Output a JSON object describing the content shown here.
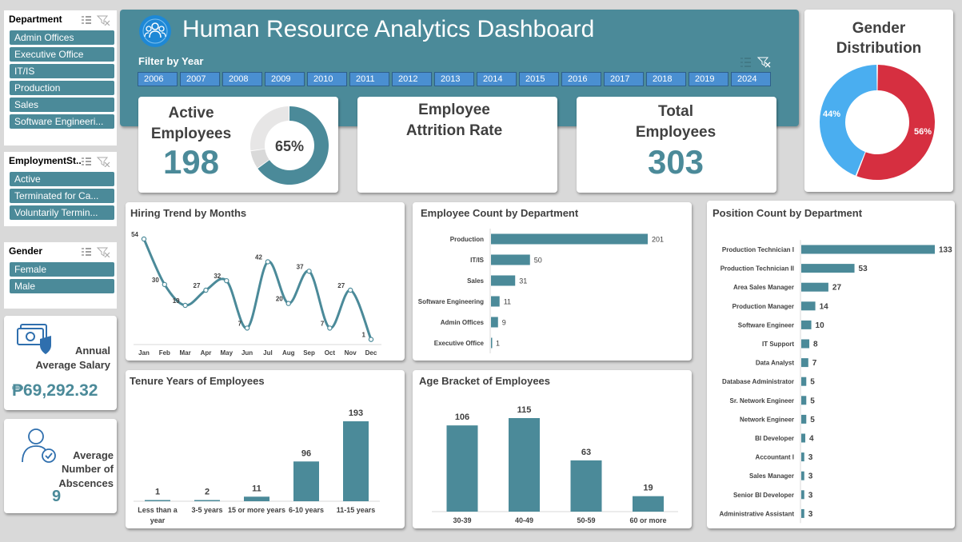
{
  "colors": {
    "teal": "#4b8a99",
    "blue": "#4aaef0",
    "red": "#d62f40",
    "grey": "#d9d9d9"
  },
  "slicers": {
    "department": {
      "title": "Department",
      "items": [
        "Admin Offices",
        "Executive Office",
        "IT/IS",
        "Production",
        "Sales",
        "Software Engineeri..."
      ]
    },
    "employment_status": {
      "title": "EmploymentSt...",
      "items": [
        "Active",
        "Terminated for Ca...",
        "Voluntarily Termin..."
      ]
    },
    "gender": {
      "title": "Gender",
      "items": [
        "Female",
        "Male"
      ]
    }
  },
  "header": {
    "title": "Human Resource Analytics Dashboard",
    "filter_label": "Filter by Year",
    "years": [
      "2006",
      "2007",
      "2008",
      "2009",
      "2010",
      "2011",
      "2012",
      "2013",
      "2014",
      "2015",
      "2016",
      "2017",
      "2018",
      "2019",
      "2024"
    ]
  },
  "kpis": {
    "active": {
      "title_line1": "Active",
      "title_line2": "Employees",
      "value": "198",
      "percent": "65%",
      "fraction": 0.65
    },
    "attrition": {
      "title_line1": "Employee",
      "title_line2": "Attrition Rate"
    },
    "total": {
      "title_line1": "Total",
      "title_line2": "Employees",
      "value": "303"
    },
    "salary": {
      "title_line1": "Annual",
      "title_line2": "Average Salary",
      "value": "₱69,292.32"
    },
    "absences": {
      "title_line1": "Average",
      "title_line2": "Number of",
      "title_line3": "Abscences",
      "value": "9"
    }
  },
  "gender_chart": {
    "title_line1": "Gender",
    "title_line2": "Distribution"
  },
  "chart_data": [
    {
      "id": "gender",
      "type": "pie",
      "title": "Gender Distribution",
      "categories": [
        "Female",
        "Male"
      ],
      "values": [
        56,
        44
      ],
      "labels": [
        "56%",
        "44%"
      ]
    },
    {
      "id": "hiring",
      "type": "line",
      "title": "Hiring Trend by Months",
      "categories": [
        "Jan",
        "Feb",
        "Mar",
        "Apr",
        "May",
        "Jun",
        "Jul",
        "Aug",
        "Sep",
        "Oct",
        "Nov",
        "Dec"
      ],
      "values": [
        54,
        30,
        19,
        27,
        32,
        7,
        42,
        20,
        37,
        7,
        27,
        1
      ]
    },
    {
      "id": "dept",
      "type": "bar",
      "title": "Employee Count by Department",
      "categories": [
        "Production",
        "IT/IS",
        "Sales",
        "Software Engineering",
        "Admin Offices",
        "Executive Office"
      ],
      "values": [
        201,
        50,
        31,
        11,
        9,
        1
      ]
    },
    {
      "id": "position",
      "type": "bar",
      "title": "Position Count by Department",
      "categories": [
        "Production Technician I",
        "Production Technician II",
        "Area Sales Manager",
        "Production Manager",
        "Software Engineer",
        "IT Support",
        "Data Analyst",
        "Database Administrator",
        "Sr. Network Engineer",
        "Network Engineer",
        "BI Developer",
        "Accountant I",
        "Sales Manager",
        "Senior BI Developer",
        "Administrative Assistant"
      ],
      "values": [
        133,
        53,
        27,
        14,
        10,
        8,
        7,
        5,
        5,
        5,
        4,
        3,
        3,
        3,
        3
      ]
    },
    {
      "id": "tenure",
      "type": "bar",
      "title": "Tenure Years of Employees",
      "categories": [
        "Less than a year",
        "3-5 years",
        "15 or more years",
        "6-10 years",
        "11-15 years"
      ],
      "values": [
        1,
        2,
        11,
        96,
        193
      ]
    },
    {
      "id": "age",
      "type": "bar",
      "title": "Age Bracket of Employees",
      "categories": [
        "30-39",
        "40-49",
        "50-59",
        "60 or more"
      ],
      "values": [
        106,
        115,
        63,
        19
      ]
    }
  ]
}
